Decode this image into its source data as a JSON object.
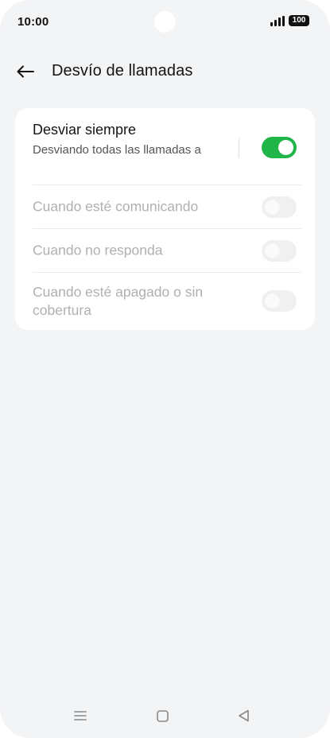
{
  "status_bar": {
    "time": "10:00",
    "battery": "100",
    "signal_icon": "signal-bars-icon"
  },
  "header": {
    "title": "Desvío de llamadas",
    "back_icon": "arrow-left-icon"
  },
  "settings": [
    {
      "label": "Desviar siempre",
      "subtitle": "Desviando todas las llamadas a",
      "enabled": true,
      "toggle_on": true
    },
    {
      "label": "Cuando esté comunicando",
      "enabled": false,
      "toggle_on": false
    },
    {
      "label": "Cuando no responda",
      "enabled": false,
      "toggle_on": false
    },
    {
      "label": "Cuando esté apagado o sin cobertura",
      "enabled": false,
      "toggle_on": false
    }
  ],
  "colors": {
    "background": "#f3f4f6",
    "card": "#ffffff",
    "toggle_on": "#1fb547",
    "disabled_text": "#b0b0b0"
  },
  "navbar": {
    "menu_icon": "menu-icon",
    "home_icon": "home-square-icon",
    "back_icon": "triangle-back-icon"
  }
}
